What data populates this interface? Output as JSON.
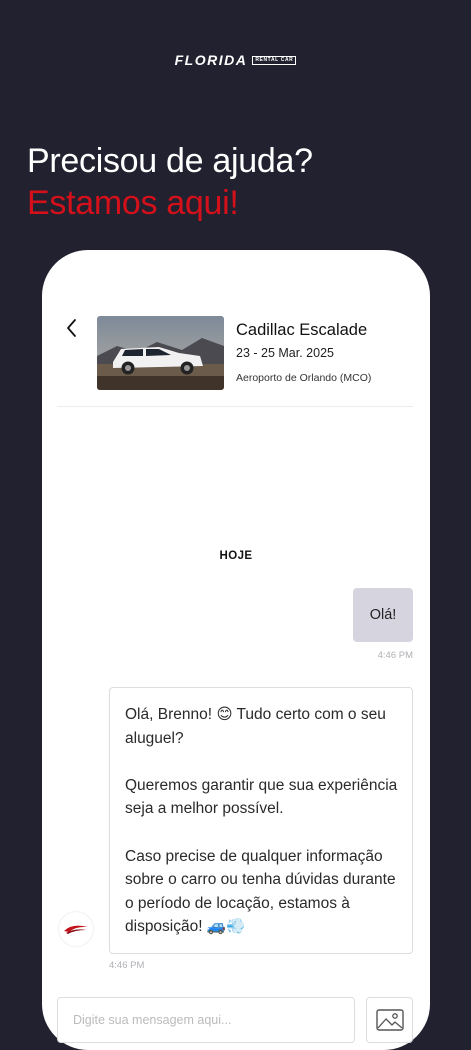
{
  "brand": {
    "name": "FLORIDA",
    "sub": "RENTAL CAR"
  },
  "headline": {
    "line1": "Precisou de ajuda?",
    "line2": "Estamos aqui!"
  },
  "reservation": {
    "car": "Cadillac Escalade",
    "dates": "23 - 25 Mar. 2025",
    "location": "Aeroporto de Orlando (MCO)"
  },
  "chat": {
    "day_label": "HOJE",
    "messages": [
      {
        "from": "user",
        "text": "Olá!",
        "time": "4:46 PM"
      },
      {
        "from": "agent",
        "paragraphs": [
          "Olá, Brenno! 😊 Tudo certo com o seu aluguel?",
          "Queremos garantir que sua experiência seja a melhor possível.",
          "Caso precise de qualquer informação sobre o carro ou tenha dúvidas durante o período de locação, estamos à disposição! 🚙💨"
        ],
        "time": "4:46 PM"
      }
    ],
    "input_placeholder": "Digite sua mensagem aqui..."
  },
  "colors": {
    "background": "#22212f",
    "accent": "#d4101a",
    "user_bubble": "#d6d5df"
  },
  "icons": [
    "back-chevron-icon",
    "image-upload-icon",
    "brand-avatar-icon"
  ]
}
